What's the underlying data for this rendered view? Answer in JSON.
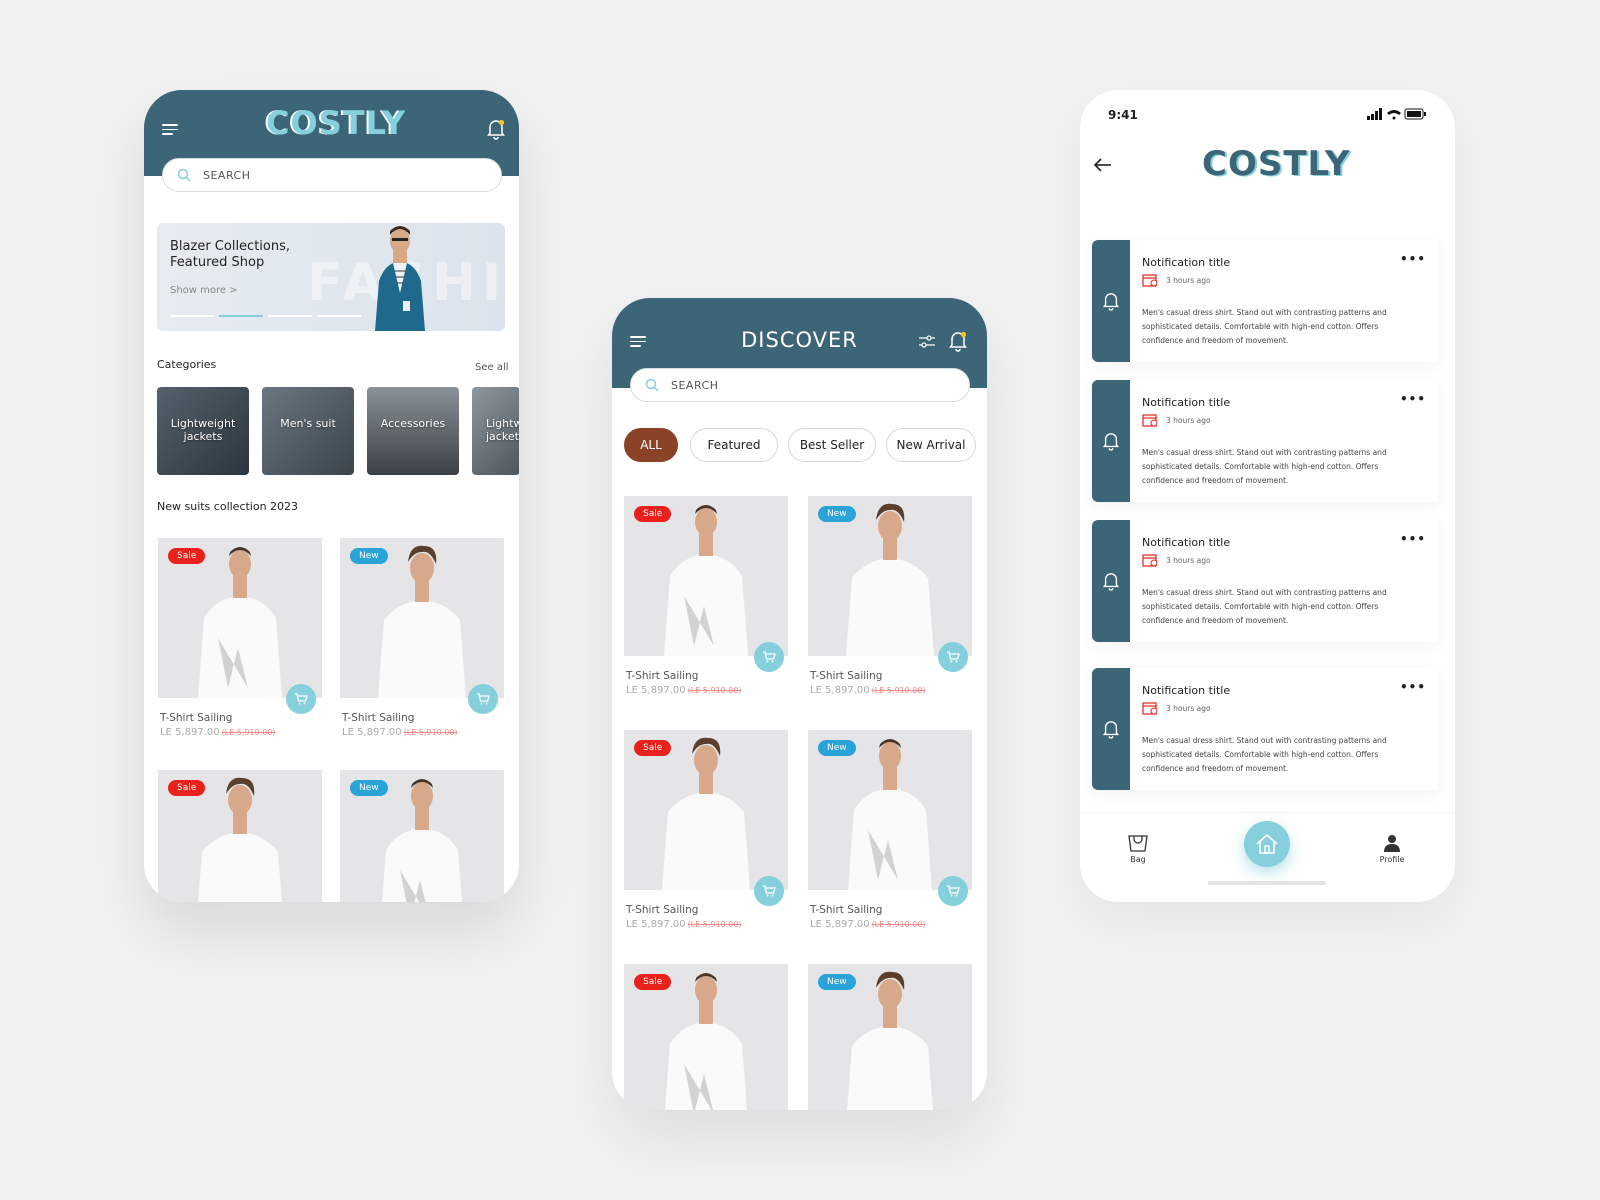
{
  "brand": "COSTLY",
  "search_placeholder": "SEARCH",
  "home": {
    "banner_title": "Blazer Collections, Featured Shop",
    "banner_more": "Show more >",
    "banner_watermark": "FASHION",
    "categories_title": "Categories",
    "see_all": "See all",
    "categories": [
      "Lightweight jackets",
      "Men's suit",
      "Accessories",
      "Lightweight jackets"
    ],
    "collection_title": "New suits collection 2023"
  },
  "discover": {
    "title": "DISCOVER",
    "chips": [
      "ALL",
      "Featured",
      "Best Seller",
      "New Arrival"
    ]
  },
  "product": {
    "name": "T-Shirt Sailing",
    "price": "LE 5,897.00",
    "old_price": "(LE 5,910.00)",
    "sale_label": "Sale",
    "new_label": "New"
  },
  "notifications": {
    "status_time": "9:41",
    "items": [
      {
        "title": "Notification title",
        "time": "3 hours ago",
        "desc": "Men's casual dress shirt. Stand out with contrasting patterns and sophisticated details. Comfortable with high-end cotton. Offers confidence and freedom of movement."
      },
      {
        "title": "Notification title",
        "time": "3 hours ago",
        "desc": "Men's casual dress shirt. Stand out with contrasting patterns and sophisticated details. Comfortable with high-end cotton. Offers confidence and freedom of movement."
      },
      {
        "title": "Notification title",
        "time": "3 hours ago",
        "desc": "Men's casual dress shirt. Stand out with contrasting patterns and sophisticated details. Comfortable with high-end cotton. Offers confidence and freedom of movement."
      },
      {
        "title": "Notification title",
        "time": "3 hours ago",
        "desc": "Men's casual dress shirt. Stand out with contrasting patterns and sophisticated details. Comfortable with high-end cotton. Offers confidence and freedom of movement."
      }
    ],
    "nav": {
      "bag": "Bag",
      "profile": "Profile"
    }
  },
  "colors": {
    "teal": "#3c6577",
    "accent": "#86cfdc",
    "sale": "#e8211c",
    "new": "#2aa3d8",
    "chip_active": "#8a4326"
  }
}
